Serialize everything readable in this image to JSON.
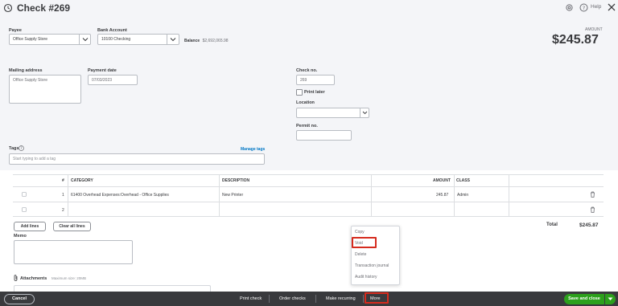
{
  "header": {
    "title": "Check #269",
    "help_label": "Help",
    "amount_label": "AMOUNT",
    "amount_value": "$245.87"
  },
  "form": {
    "payee_label": "Payee",
    "payee_value": "Office Supply Store",
    "bank_account_label": "Bank Account",
    "bank_account_value": "10100 Checking",
    "balance_label": "Balance",
    "balance_value": "$2,692,065.98",
    "mailing_address_label": "Mailing address",
    "mailing_address_value": "Office Supply Store",
    "payment_date_label": "Payment date",
    "payment_date_value": "07/03/2023",
    "check_no_label": "Check no.",
    "check_no_value": "269",
    "print_later_label": "Print later",
    "location_label": "Location",
    "permit_no_label": "Permit no.",
    "tags_label": "Tags",
    "manage_tags_label": "Manage tags",
    "tags_placeholder": "Start typing to add a tag"
  },
  "table": {
    "columns": [
      "#",
      "CATEGORY",
      "DESCRIPTION",
      "AMOUNT",
      "CLASS"
    ],
    "rows": [
      {
        "num": "1",
        "category": "61400 Overhead Expenses:Overhead - Office Supplies",
        "description": "New Printer",
        "amount": "245.87",
        "class": "Admin"
      },
      {
        "num": "2",
        "category": "",
        "description": "",
        "amount": "",
        "class": ""
      }
    ],
    "add_lines_label": "Add lines",
    "clear_lines_label": "Clear all lines",
    "total_label": "Total",
    "total_value": "$245.87"
  },
  "memo": {
    "label": "Memo",
    "attachments_label": "Attachments",
    "max_size_label": "Maximum size: 20MB"
  },
  "more_menu": {
    "items": [
      "Copy",
      "Void",
      "Delete",
      "Transaction journal",
      "Audit history"
    ]
  },
  "footer": {
    "cancel_label": "Cancel",
    "print_check_label": "Print check",
    "order_checks_label": "Order checks",
    "make_recurring_label": "Make recurring",
    "more_label": "More",
    "save_close_label": "Save and close"
  },
  "colors": {
    "highlight": "#d52b1e",
    "save_green": "#2ca01c",
    "link_blue": "#0077c5",
    "footer_bg": "#393a3d"
  }
}
